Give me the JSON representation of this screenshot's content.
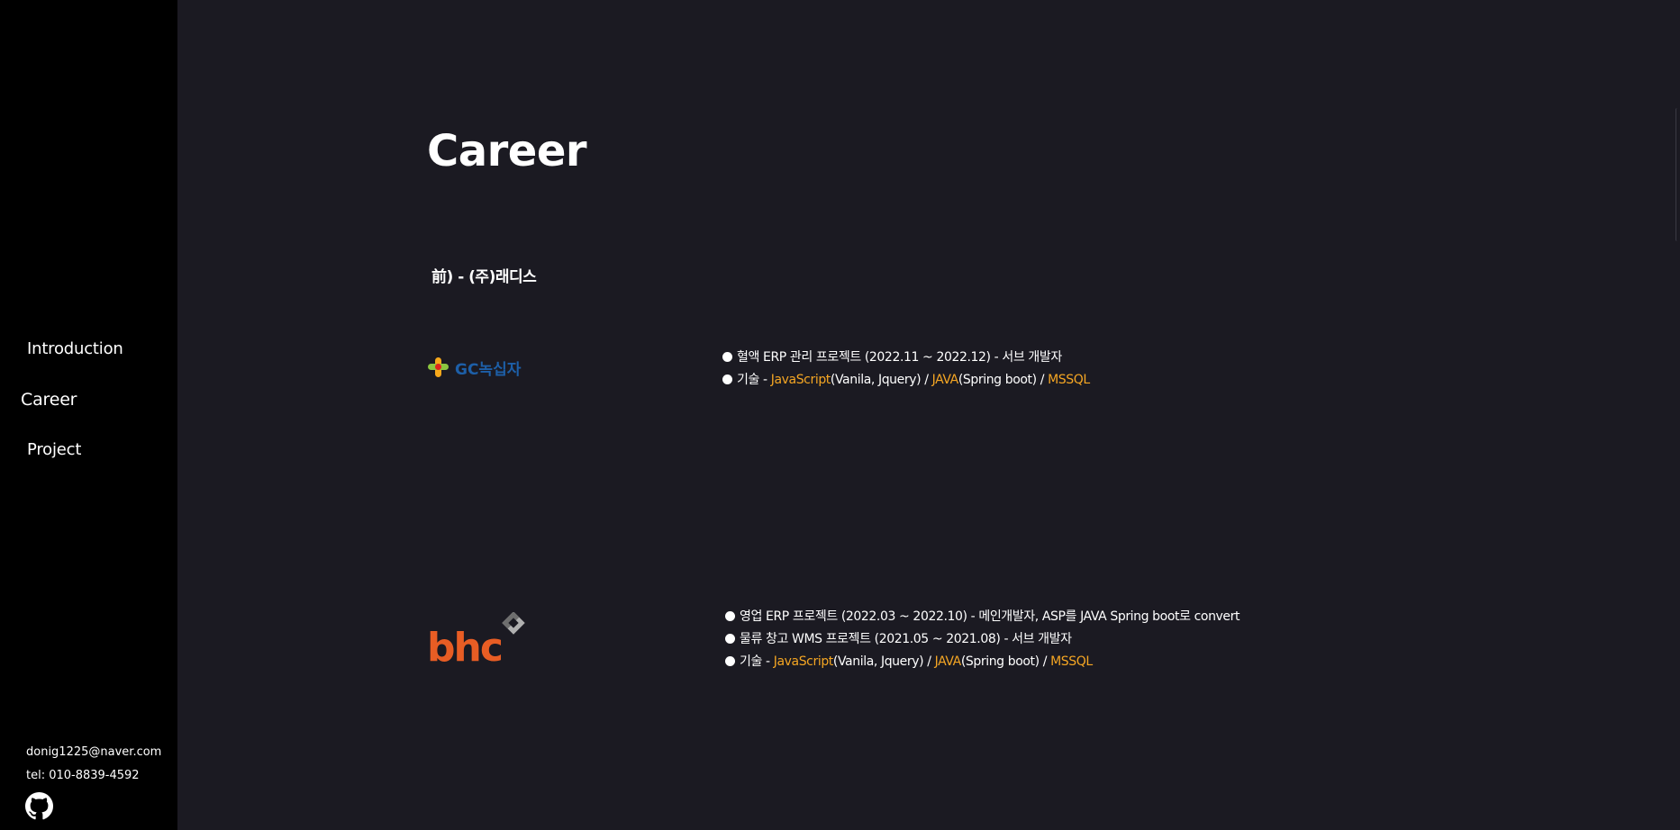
{
  "sidebar": {
    "nav": [
      {
        "label": "Introduction"
      },
      {
        "label": "Career",
        "active": true
      },
      {
        "label": "Project"
      }
    ],
    "email": "donig1225@naver.com",
    "tel": "tel: 010-8839-4592",
    "github_icon": "github-icon"
  },
  "main": {
    "title": "Career",
    "company": "前) - (주)래디스",
    "gc": {
      "logo_text": "GC녹십자",
      "project": "혈액 ERP 관리 프로젝트 (2022.11 ~ 2022.12) - 서브 개발자",
      "tech_prefix": "기술 - ",
      "tech": [
        {
          "name": "JavaScript",
          "detail": "(Vanila, Jquery) / "
        },
        {
          "name": "JAVA",
          "detail": "(Spring boot) / "
        },
        {
          "name": "MSSQL",
          "detail": ""
        }
      ]
    },
    "bhc": {
      "logo_text": "bhc",
      "projects": [
        "영업 ERP 프로젝트 (2022.03 ~ 2022.10) - 메인개발자, ASP를 JAVA Spring boot로 convert",
        "물류 창고 WMS 프로젝트 (2021.05 ~ 2021.08) - 서브 개발자"
      ],
      "tech_prefix": "기술 - ",
      "tech": [
        {
          "name": "JavaScript",
          "detail": "(Vanila, Jquery) / "
        },
        {
          "name": "JAVA",
          "detail": "(Spring boot) / "
        },
        {
          "name": "MSSQL",
          "detail": ""
        }
      ]
    }
  },
  "colors": {
    "highlight": "#f5a623",
    "background": "#1b1a22",
    "sidebar": "#000000",
    "bhc_orange": "#e85d24",
    "gc_blue": "#1d5fa8"
  }
}
